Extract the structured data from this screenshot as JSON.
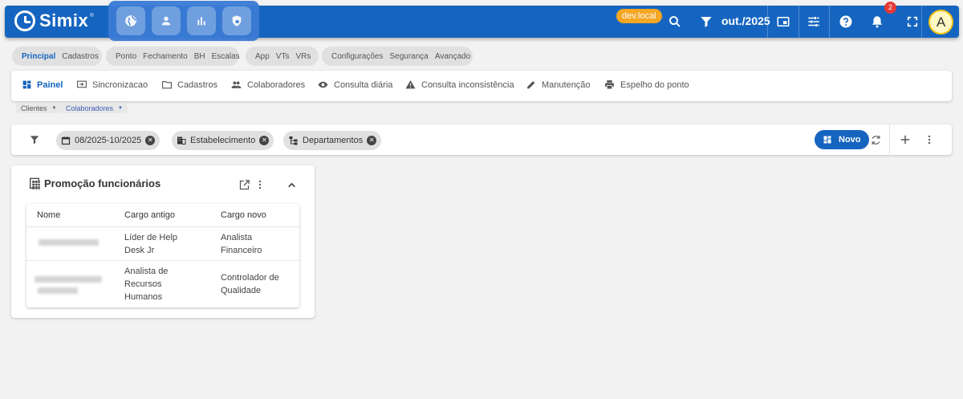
{
  "app": {
    "name": "Simix",
    "sup": "®"
  },
  "topbar": {
    "env": "dev.local",
    "period": "out./2025",
    "notifications": "2",
    "avatar": "A",
    "icons": [
      "search-icon",
      "filter-icon",
      "picture-in-picture-icon",
      "tune-icon",
      "help-icon",
      "bell-icon",
      "fullscreen-icon"
    ]
  },
  "modules": [
    "globe-icon",
    "person-icon",
    "bar-chart-icon",
    "shield-lock-icon"
  ],
  "chipgroups": [
    {
      "items": [
        "Principal",
        "Cadastros"
      ],
      "active": 0
    },
    {
      "items": [
        "Ponto",
        "Fechamento",
        "BH",
        "Escalas"
      ],
      "active": -1
    },
    {
      "items": [
        "App",
        "VTs",
        "VRs"
      ],
      "active": -1
    },
    {
      "items": [
        "Configurações",
        "Segurança",
        "Avançado"
      ],
      "active": -1
    }
  ],
  "nav": {
    "items": [
      "Painel",
      "Sincronizacao",
      "Cadastros",
      "Colaboradores",
      "Consulta diária",
      "Consulta inconsistência",
      "Manutenção",
      "Espelho do ponto"
    ]
  },
  "subtabs": [
    "Clientes",
    "Colaboradores"
  ],
  "filters": {
    "chips": [
      "08/2025-10/2025",
      "Estabelecimento",
      "Departamentos"
    ],
    "new_label": "Novo"
  },
  "widget": {
    "title": "Promoção funcionários",
    "columns": [
      "Nome",
      "Cargo antigo",
      "Cargo novo"
    ],
    "rows": [
      {
        "old": [
          "Líder de Help",
          "Desk Jr"
        ],
        "new": [
          "Analista",
          "Financeiro"
        ]
      },
      {
        "old": [
          "Analista de",
          "Recursos",
          "Humanos"
        ],
        "new": [
          "Controlador de",
          "Qualidade"
        ]
      }
    ]
  },
  "colors": {
    "primary": "#1565c0",
    "badge": "#f5a623",
    "notif": "#e53935"
  }
}
